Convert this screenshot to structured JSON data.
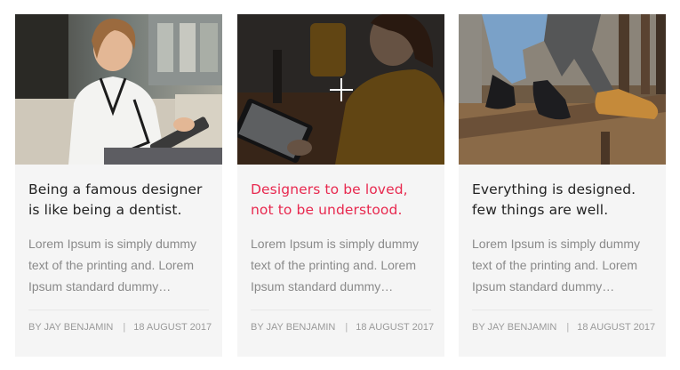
{
  "posts": [
    {
      "image_icon": "photo-woman-tablet-office",
      "title": "Being a famous designer is like being a dentist.",
      "excerpt": "Lorem Ipsum is simply dummy text of the printing and. Lorem Ipsum standard dummy…",
      "author": "BY JAY BENJAMIN",
      "date": "18 AUGUST 2017",
      "separator": "|"
    },
    {
      "image_icon": "photo-woman-tablet-yellow-sweater",
      "title": "Designers to be loved, not to be understood.",
      "excerpt": "Lorem Ipsum is simply dummy text of the printing and. Lorem Ipsum standard dummy…",
      "author": "BY JAY BENJAMIN",
      "date": "18 AUGUST 2017",
      "separator": "|",
      "hover_icon": "plus-icon"
    },
    {
      "image_icon": "photo-couple-boots-bench",
      "title": "Everything is designed. few things are well.",
      "excerpt": "Lorem Ipsum is simply dummy text of the printing and. Lorem Ipsum standard dummy…",
      "author": "BY JAY BENJAMIN",
      "date": "18 AUGUST 2017",
      "separator": "|"
    }
  ],
  "colors": {
    "accent": "#e8294f",
    "title": "#222222",
    "text": "#8a8a8a",
    "card_bg": "#f5f5f5"
  }
}
